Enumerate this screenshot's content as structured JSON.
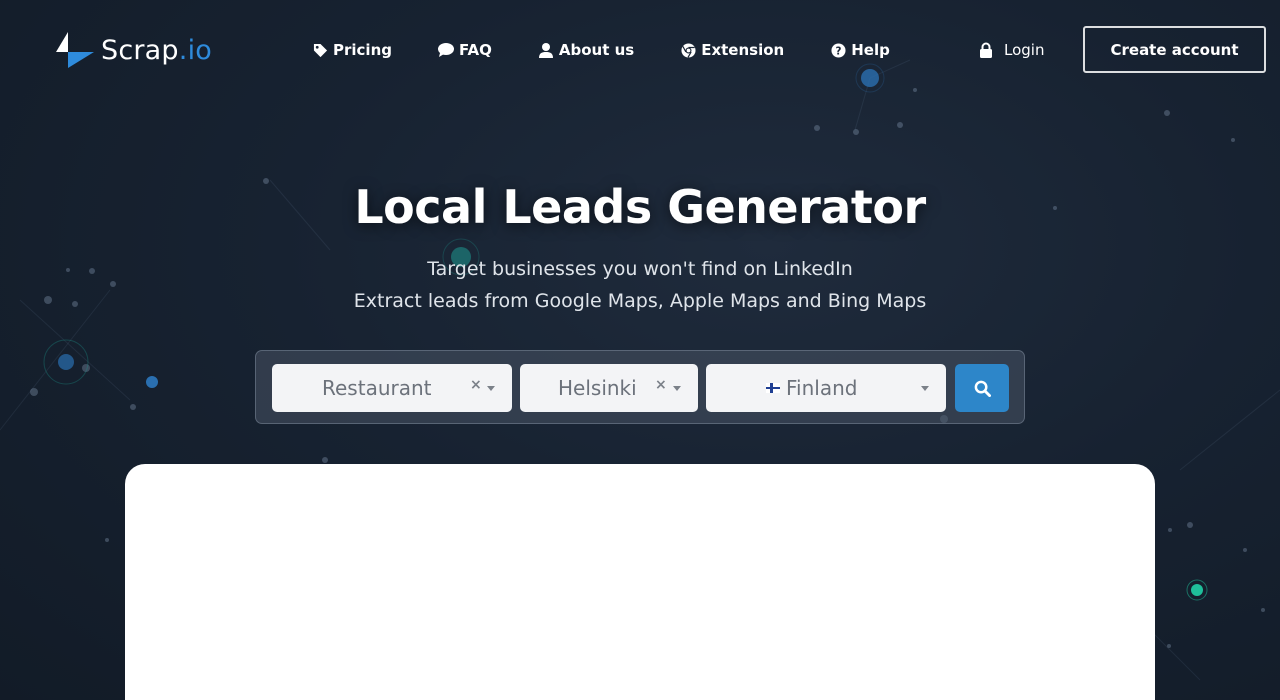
{
  "brand": {
    "name": "Scrap",
    "suffix": ".io",
    "accent": "#2e8bdc"
  },
  "nav": {
    "items": [
      {
        "label": "Pricing",
        "icon": "tag-icon"
      },
      {
        "label": "FAQ",
        "icon": "chat-bubble-icon"
      },
      {
        "label": "About us",
        "icon": "user-icon"
      },
      {
        "label": "Extension",
        "icon": "chrome-icon"
      },
      {
        "label": "Help",
        "icon": "question-circle-icon"
      }
    ],
    "login_label": "Login",
    "login_icon": "lock-icon",
    "create_account_label": "Create account"
  },
  "hero": {
    "title": "Local Leads Generator",
    "subtitle_line1": "Target businesses you won't find on LinkedIn",
    "subtitle_line2": "Extract leads from Google Maps, Apple Maps and Bing Maps"
  },
  "search": {
    "category_value": "Restaurant",
    "city_value": "Helsinki",
    "country_value": "Finland",
    "clear_symbol": "×",
    "search_icon": "magnifier-icon",
    "button_color": "#2d86c9"
  }
}
